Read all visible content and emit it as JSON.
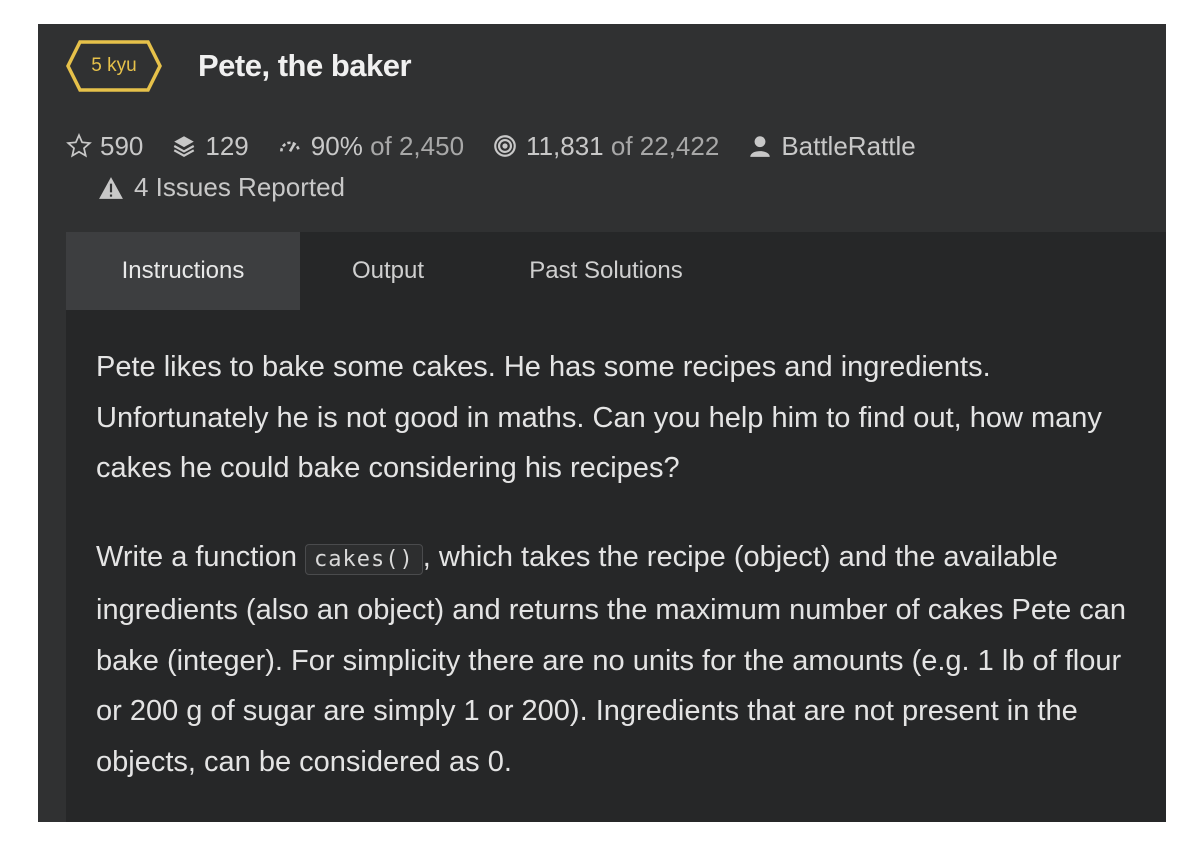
{
  "kata": {
    "rank": "5 kyu",
    "title": "Pete, the baker",
    "stats": {
      "stars": "590",
      "collections": "129",
      "satisfaction": "90%",
      "satisfaction_of": "of 2,450",
      "completed": "11,831",
      "completed_of": "of 22,422",
      "author": "BattleRattle"
    },
    "issues": "4 Issues Reported"
  },
  "tabs": [
    "Instructions",
    "Output",
    "Past Solutions"
  ],
  "description": {
    "p1": "Pete likes to bake some cakes. He has some recipes and ingredients. Unfortunately he is not good in maths. Can you help him to find out, how many cakes he could bake considering his recipes?",
    "p2_before": "Write a function ",
    "p2_code": "cakes()",
    "p2_after": ", which takes the recipe (object) and the available ingredients (also an object) and returns the maximum number of cakes Pete can bake (integer). For simplicity there are no units for the amounts (e.g. 1 lb of flour or 200 g of sugar are simply 1 or 200). Ingredients that are not present in the objects, can be considered as 0."
  },
  "colors": {
    "rank": "#e6c14a",
    "panel": "#303132",
    "content": "#262728"
  }
}
